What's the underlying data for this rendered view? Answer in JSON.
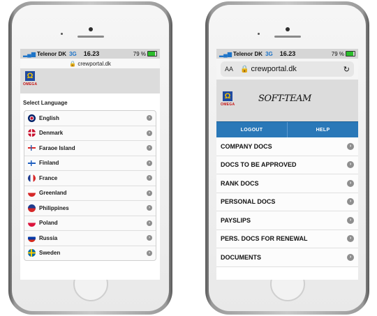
{
  "left_phone": {
    "status": {
      "carrier": "Telenor DK",
      "network": "3G",
      "time": "16.23",
      "battery": "79 %"
    },
    "url": "crewportal.dk",
    "logo_text": "OMEGA",
    "logo_glyph": "Ω",
    "select_title": "Select Language",
    "languages": [
      {
        "label": "English"
      },
      {
        "label": "Denmark"
      },
      {
        "label": "Faraoe Island"
      },
      {
        "label": "Finland"
      },
      {
        "label": "France"
      },
      {
        "label": "Greenland"
      },
      {
        "label": "Philippines"
      },
      {
        "label": "Poland"
      },
      {
        "label": "Russia"
      },
      {
        "label": "Sweden"
      }
    ]
  },
  "right_phone": {
    "status": {
      "carrier": "Telenor DK",
      "network": "3G",
      "time": "16.23",
      "battery": "79 %"
    },
    "url_aa": "AA",
    "url": "crewportal.dk",
    "logo_text": "OMEGA",
    "logo_glyph": "Ω",
    "brand": "SOFT-TEAM",
    "logout_label": "LOGOUT",
    "help_label": "HELP",
    "docs": [
      {
        "label": "COMPANY DOCS"
      },
      {
        "label": "DOCS TO BE APPROVED"
      },
      {
        "label": "RANK DOCS"
      },
      {
        "label": "PERSONAL DOCS"
      },
      {
        "label": "PAYSLIPS"
      },
      {
        "label": "PERS. DOCS FOR RENEWAL"
      },
      {
        "label": "DOCUMENTS"
      }
    ]
  },
  "colors": {
    "accent_blue": "#2a78b8",
    "omega_blue": "#1f4aa0",
    "omega_red": "#c41010"
  }
}
